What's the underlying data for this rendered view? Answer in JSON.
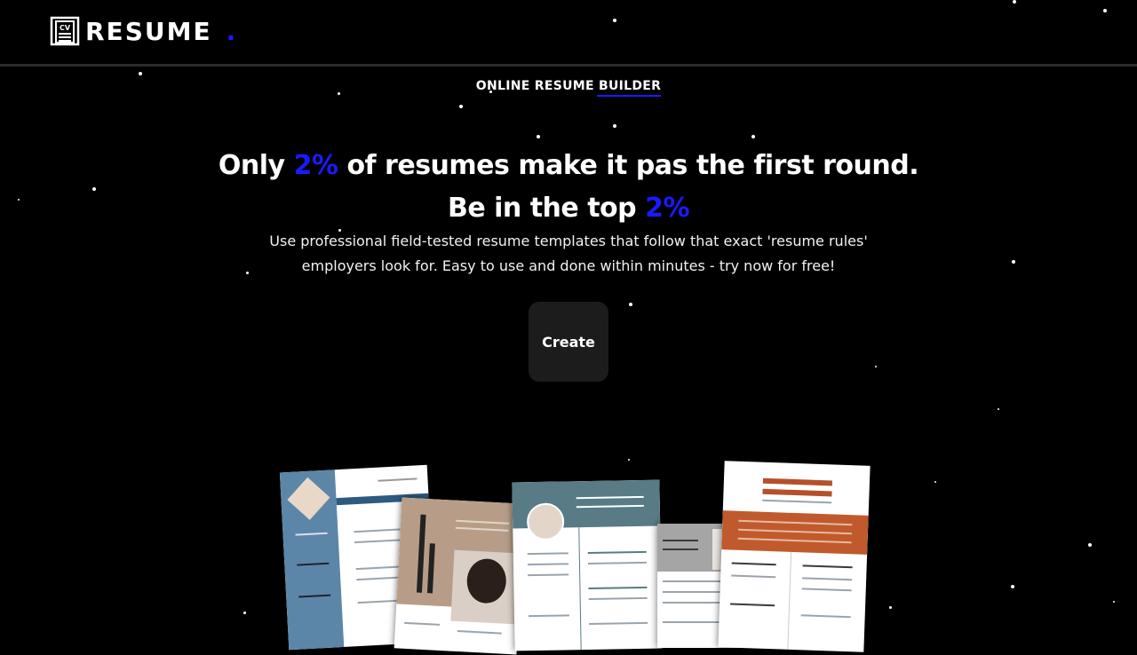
{
  "header": {
    "logo_text": "RESUME",
    "logo_dot": ".",
    "logo_icon": "cv-document-icon"
  },
  "hero": {
    "eyebrow": "ONLINE RESUME BUILDER",
    "headline_part1": "Only ",
    "headline_accent1": "2%",
    "headline_part2": " of resumes make it pas the first round. Be in the top ",
    "headline_accent2": "2%",
    "subtext": "Use professional field-tested resume templates that follow that exact 'resume rules' employers look for. Easy to use and done within minutes - try now for free!",
    "cta_label": "Create"
  },
  "colors": {
    "background": "#000000",
    "accent": "#1a1aff",
    "button_bg": "#1c1c1c"
  }
}
